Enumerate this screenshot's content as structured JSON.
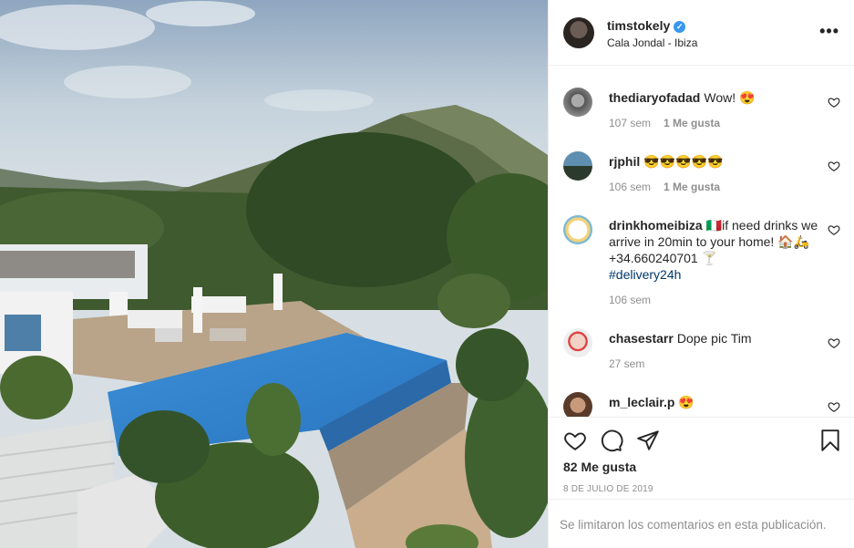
{
  "post": {
    "username": "timstokely",
    "verified": true,
    "location": "Cala Jondal - Ibiza",
    "more_icon": "ellipsis-icon"
  },
  "comments": [
    {
      "user": "thediaryofadad",
      "text": "Wow! 😍",
      "age": "107 sem",
      "likes": "1 Me gusta"
    },
    {
      "user": "rjphil",
      "text": "😎😎😎😎😎",
      "age": "106 sem",
      "likes": "1 Me gusta"
    },
    {
      "user": "drinkhomeibiza",
      "text": "🇮🇹if need drinks we arrive in 20min to your home! 🏠🛵+34.660240701 🍸",
      "hashtag": "#delivery24h",
      "age": "106 sem",
      "likes": ""
    },
    {
      "user": "chasestarr",
      "text": "Dope pic Tim",
      "age": "27 sem",
      "likes": ""
    },
    {
      "user": "m_leclair.p",
      "text": "😍",
      "age": "",
      "likes": ""
    }
  ],
  "actions": {
    "like_icon": "heart-icon",
    "comment_icon": "comment-icon",
    "share_icon": "send-icon",
    "save_icon": "bookmark-icon"
  },
  "likes_count": "82 Me gusta",
  "date": "8 DE JULIO DE 2019",
  "comments_limited": "Se limitaron los comentarios en esta publicación."
}
